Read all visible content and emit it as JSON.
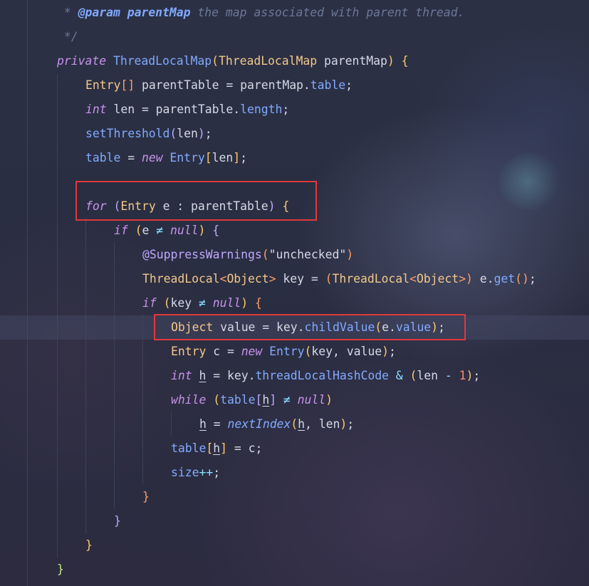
{
  "code_lines": {
    "l1_prefix": " * ",
    "l1_tag": "@param",
    "l1_name": " parentMap",
    "l1_text": " the map associated with parent thread.",
    "l2": " */",
    "l3_private": "private",
    "l3_ctor": "ThreadLocalMap",
    "l3_paren_open": "(",
    "l3_type": "ThreadLocalMap",
    "l3_param": " parentMap",
    "l3_paren_close": ")",
    "l3_brace": " {",
    "l4_type": "Entry",
    "l4_arr": "[]",
    "l4_var": " parentTable = parentMap.",
    "l4_field": "table",
    "l4_end": ";",
    "l5_int": "int",
    "l5_var": " len = parentTable.",
    "l5_field": "length",
    "l5_end": ";",
    "l6_call": "setThreshold",
    "l6_open": "(",
    "l6_arg": "len",
    "l6_close": ")",
    "l6_end": ";",
    "l7_field": "table",
    "l7_eq": " = ",
    "l7_new": "new",
    "l7_type": " Entry",
    "l7_open": "[",
    "l7_arg": "len",
    "l7_close": "]",
    "l7_end": ";",
    "l8_for": "for",
    "l8_open": " (",
    "l8_type": "Entry",
    "l8_rest": " e : parentTable",
    "l8_close": ")",
    "l8_brace": " {",
    "l9_if": "if",
    "l9_open": " (",
    "l9_cond": "e ",
    "l9_ne": "≠",
    "l9_null": " null",
    "l9_close": ")",
    "l9_brace": " {",
    "l10_anno": "@SuppressWarnings",
    "l10_open": "(",
    "l10_str": "\"unchecked\"",
    "l10_close": ")",
    "l11_type": "ThreadLocal",
    "l11_lt": "<",
    "l11_obj": "Object",
    "l11_gt": ">",
    "l11_key": " key = ",
    "l11_open": "(",
    "l11_type2": "ThreadLocal",
    "l11_lt2": "<",
    "l11_obj2": "Object",
    "l11_gt2": ">",
    "l11_close": ")",
    "l11_e": " e.",
    "l11_get": "get",
    "l11_call": "()",
    "l11_end": ";",
    "l12_if": "if",
    "l12_open": " (",
    "l12_cond": "key ",
    "l12_ne": "≠",
    "l12_null": " null",
    "l12_close": ")",
    "l12_brace": " {",
    "l13_type": "Object",
    "l13_var": " value = key.",
    "l13_fn": "childValue",
    "l13_open": "(",
    "l13_e": "e.",
    "l13_field": "value",
    "l13_close": ")",
    "l13_end": ";",
    "l14_type": "Entry",
    "l14_c": " c = ",
    "l14_new": "new",
    "l14_type2": " Entry",
    "l14_open": "(",
    "l14_args": "key, value",
    "l14_close": ")",
    "l14_end": ";",
    "l15_int": "int",
    "l15_sp": " ",
    "l15_h": "h",
    "l15_mid": " = key.",
    "l15_field": "threadLocalHashCode",
    "l15_amp": " & ",
    "l15_open": "(",
    "l15_len": "len ",
    "l15_minus": "-",
    "l15_sp2": " ",
    "l15_one": "1",
    "l15_close": ")",
    "l15_end": ";",
    "l16_while": "while",
    "l16_open": " (",
    "l16_table": "table",
    "l16_lb": "[",
    "l16_h": "h",
    "l16_rb": "]",
    "l16_ne": " ≠",
    "l16_null": " null",
    "l16_close": ")",
    "l17_h": "h",
    "l17_eq": " = ",
    "l17_fn": "nextIndex",
    "l17_open": "(",
    "l17_h2": "h",
    "l17_args": ", len",
    "l17_close": ")",
    "l17_end": ";",
    "l18_table": "table",
    "l18_lb": "[",
    "l18_h": "h",
    "l18_rb": "]",
    "l18_rest": " = c;",
    "l19_size": "size",
    "l19_inc": "++",
    "l19_end": ";",
    "l20": "}",
    "l21": "}",
    "l22": "}",
    "l23": "}"
  },
  "colors": {
    "highlight_border": "#e0393b",
    "background": "#2a2e42"
  }
}
